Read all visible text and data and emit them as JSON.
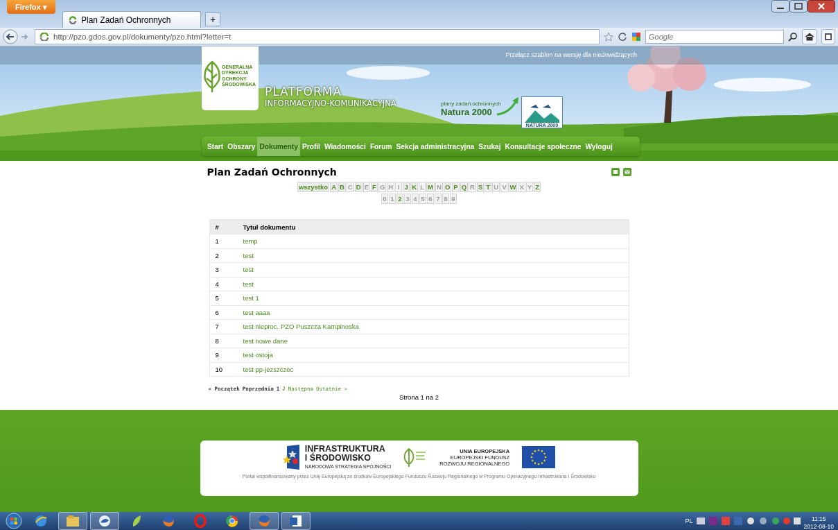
{
  "browser": {
    "menu_button": "Firefox ▾",
    "tab": {
      "title": "Plan Zadań Ochronnych",
      "selected": true
    },
    "new_tab": "+",
    "url": "http://pzo.gdos.gov.pl/dokumenty/pzo.html?letter=t",
    "search_placeholder": "Google"
  },
  "header": {
    "accessibility_link": "Przełącz szablon na wersję dla niedowidzących",
    "logo_text": [
      "GENERALNA",
      "DYREKCJA",
      "OCHRONY",
      "ŚRODOWISKA"
    ],
    "platform_title": "PLATFORMA",
    "platform_subtitle": "INFORMACYJNO-KOMUNIKACYJNA",
    "natura_caption": "plany zadań ochronnych",
    "natura_title": "Natura 2000",
    "natura_logo_text": "NATURA 2000"
  },
  "menu": [
    {
      "label": "Start",
      "selected": false
    },
    {
      "label": "Obszary",
      "selected": false
    },
    {
      "label": "Dokumenty",
      "selected": true
    },
    {
      "label": "Profil",
      "selected": false
    },
    {
      "label": "Wiadomości",
      "selected": false
    },
    {
      "label": "Forum",
      "selected": false
    },
    {
      "label": "Sekcja administracyjna",
      "selected": false
    },
    {
      "label": "Szukaj",
      "selected": false
    },
    {
      "label": "Konsultacje społeczne",
      "selected": false
    },
    {
      "label": "Wyloguj",
      "selected": false
    }
  ],
  "page_title": "Plan Zadań Ochronnych",
  "letters": [
    {
      "label": "wszystko",
      "enabled": true
    },
    {
      "label": "A",
      "enabled": true
    },
    {
      "label": "B",
      "enabled": true
    },
    {
      "label": "C",
      "enabled": false
    },
    {
      "label": "D",
      "enabled": true
    },
    {
      "label": "E",
      "enabled": false
    },
    {
      "label": "F",
      "enabled": true
    },
    {
      "label": "G",
      "enabled": false
    },
    {
      "label": "H",
      "enabled": false
    },
    {
      "label": "I",
      "enabled": false
    },
    {
      "label": "J",
      "enabled": true
    },
    {
      "label": "K",
      "enabled": true
    },
    {
      "label": "L",
      "enabled": false
    },
    {
      "label": "M",
      "enabled": true
    },
    {
      "label": "N",
      "enabled": false
    },
    {
      "label": "O",
      "enabled": true
    },
    {
      "label": "P",
      "enabled": true
    },
    {
      "label": "Q",
      "enabled": true
    },
    {
      "label": "R",
      "enabled": false
    },
    {
      "label": "S",
      "enabled": true
    },
    {
      "label": "T",
      "enabled": true
    },
    {
      "label": "U",
      "enabled": false
    },
    {
      "label": "V",
      "enabled": false
    },
    {
      "label": "W",
      "enabled": true
    },
    {
      "label": "X",
      "enabled": false
    },
    {
      "label": "Y",
      "enabled": false
    },
    {
      "label": "Z",
      "enabled": true
    }
  ],
  "digits": [
    {
      "label": "0",
      "enabled": false
    },
    {
      "label": "1",
      "enabled": false
    },
    {
      "label": "2",
      "enabled": true
    },
    {
      "label": "3",
      "enabled": false
    },
    {
      "label": "4",
      "enabled": false
    },
    {
      "label": "5",
      "enabled": false
    },
    {
      "label": "6",
      "enabled": false
    },
    {
      "label": "7",
      "enabled": false
    },
    {
      "label": "8",
      "enabled": false
    },
    {
      "label": "9",
      "enabled": false
    }
  ],
  "table": {
    "columns": [
      "#",
      "Tytuł dokumentu"
    ],
    "rows": [
      [
        "1",
        "temp"
      ],
      [
        "2",
        "test"
      ],
      [
        "3",
        "test"
      ],
      [
        "4",
        "test"
      ],
      [
        "5",
        "test 1"
      ],
      [
        "6",
        "test aaaa"
      ],
      [
        "7",
        "test nieproc. PZO Puszcza Kampinoska"
      ],
      [
        "8",
        "test nowe dane"
      ],
      [
        "9",
        "test ostoja"
      ],
      [
        "10",
        "test pp-jezszczec"
      ]
    ]
  },
  "pager": [
    {
      "label": "« Początek",
      "active": false
    },
    {
      "label": "Poprzednia",
      "active": false
    },
    {
      "label": "1",
      "active": false
    },
    {
      "label": "2",
      "active": true
    },
    {
      "label": "Następna",
      "active": true
    },
    {
      "label": "Ostatnie »",
      "active": true
    }
  ],
  "page_info": "Strona 1 na 2",
  "footer": {
    "infra_title": [
      "INFRASTRUKTURA",
      "I ŚRODOWISKO"
    ],
    "infra_subtitle": "NARODOWA STRATEGIA SPÓJNOŚCI",
    "eu_title": "UNIA EUROPEJSKA",
    "eu_lines": [
      "EUROPEJSKI FUNDUSZ",
      "ROZWOJU REGIONALNEGO"
    ],
    "note": "Portal współfinansowany przez Unię Europejską ze środków Europejskiego Funduszu Rozwoju Regionalnego w Programu Operacyjnego Infrastruktura i Środowisko"
  },
  "taskbar": {
    "apps": [
      {
        "kind": "globe",
        "open": false
      },
      {
        "kind": "folder",
        "open": true
      },
      {
        "kind": "bird",
        "open": true
      },
      {
        "kind": "leaf",
        "open": false
      },
      {
        "kind": "fox",
        "open": false
      },
      {
        "kind": "ring",
        "open": false
      },
      {
        "kind": "wheel",
        "open": false
      },
      {
        "kind": "fox",
        "open": true
      },
      {
        "kind": "document",
        "open": true
      }
    ],
    "language": "PL",
    "time": "11:15",
    "date": "2012-08-10"
  }
}
